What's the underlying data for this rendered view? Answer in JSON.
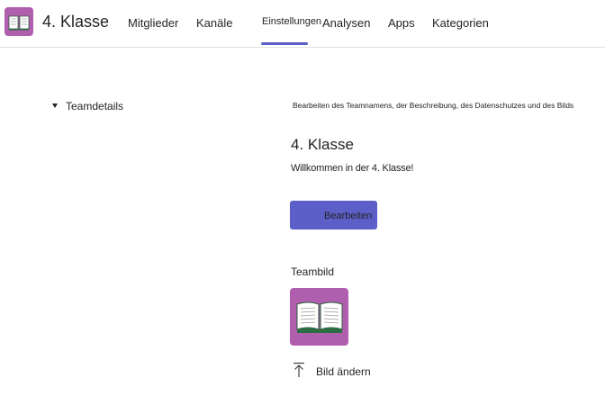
{
  "header": {
    "team_name": "4. Klasse",
    "tabs": [
      {
        "label": "Mitglieder"
      },
      {
        "label": "Kanäle"
      },
      {
        "label": "Einstellungen"
      },
      {
        "label": "Analysen"
      },
      {
        "label": "Apps"
      },
      {
        "label": "Kategorien"
      }
    ],
    "active_tab": "Einstellungen"
  },
  "sidebar": {
    "section_label": "Teamdetails"
  },
  "details": {
    "description": "Bearbeiten des Teamnamens, der Beschreibung, des Datenschutzes und des Bilds",
    "team_title": "4. Klasse",
    "welcome_text": "Willkommen in der 4. Klasse!",
    "edit_button": "Bearbeiten",
    "teambild_label": "Teambild",
    "change_picture": "Bild ändern"
  },
  "icons": {
    "team_avatar": "book-icon",
    "team_picture": "book-icon",
    "upload": "upload-icon",
    "collapse": "caret-down-icon"
  },
  "colors": {
    "accent": "#5b5fc7",
    "avatar_bg": "#b05fae"
  }
}
